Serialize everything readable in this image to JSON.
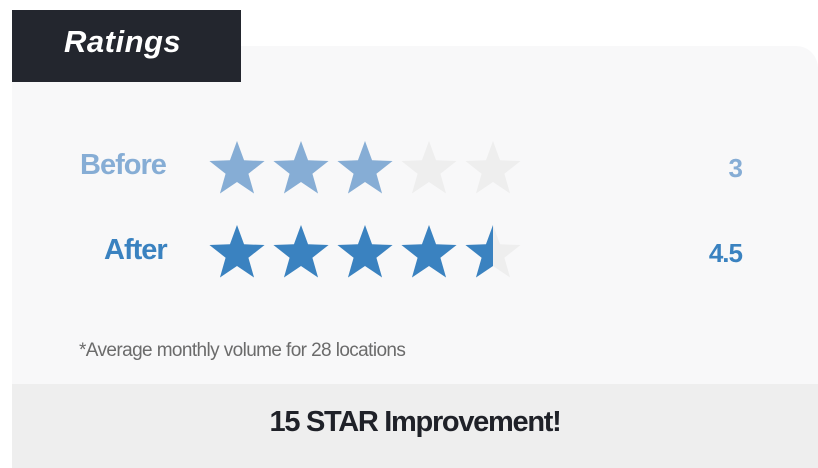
{
  "header": {
    "title": "Ratings"
  },
  "ratings": [
    {
      "label": "Before",
      "value": "3",
      "stars_filled": 3,
      "stars_total": 5,
      "color": "#86add5"
    },
    {
      "label": "After",
      "value": "4.5",
      "stars_filled": 4.5,
      "stars_total": 5,
      "color": "#3a82c0"
    }
  ],
  "footnote": "*Average monthly volume for 28 locations",
  "banner": {
    "text": "15 STAR Improvement!"
  },
  "colors": {
    "tab_background": "#23262e",
    "card_background": "#f8f8f9",
    "empty_star": "#eeeeee",
    "banner_background": "#eeeeee"
  }
}
